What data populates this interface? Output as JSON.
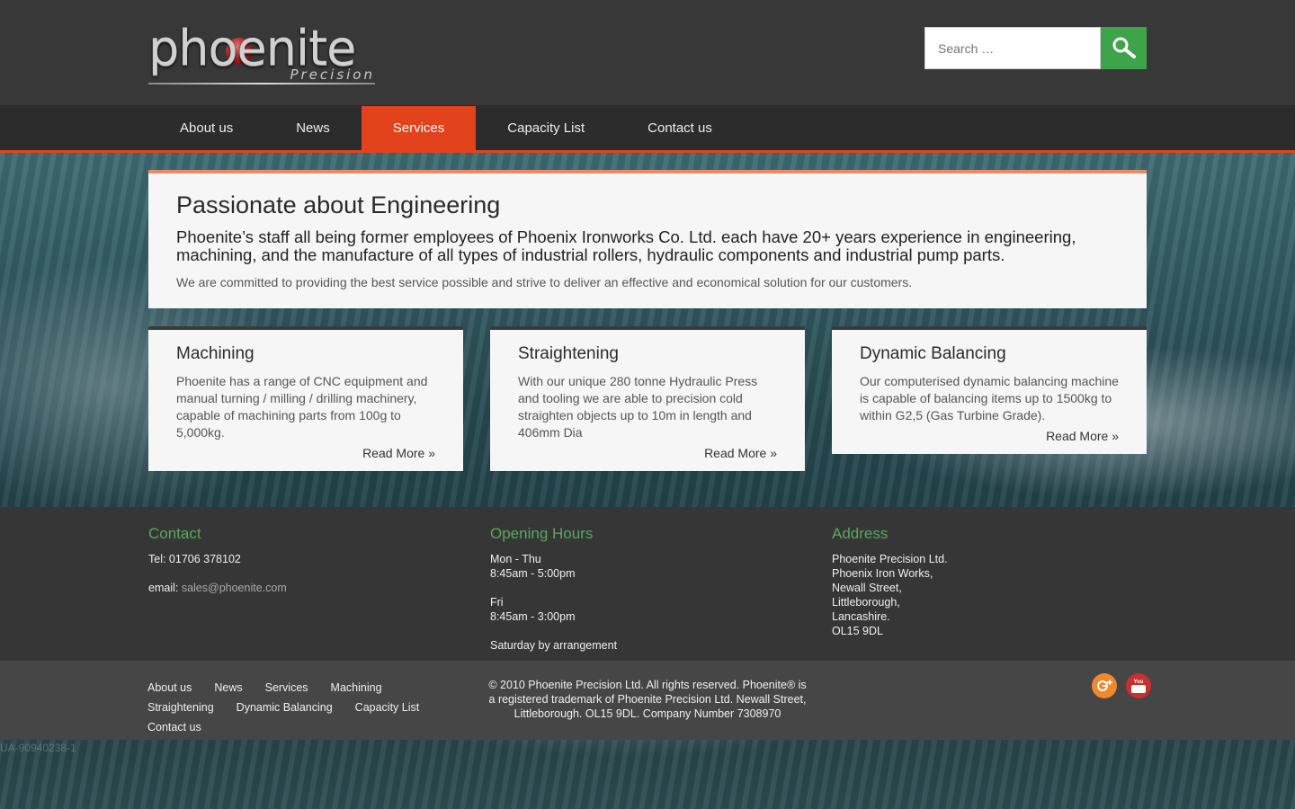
{
  "header": {
    "logo_text": "phoenite",
    "logo_sub": "Precision",
    "search_placeholder": "Search …"
  },
  "nav": {
    "items": [
      {
        "label": "About us",
        "active": false
      },
      {
        "label": "News",
        "active": false
      },
      {
        "label": "Services",
        "active": true
      },
      {
        "label": "Capacity List",
        "active": false
      },
      {
        "label": "Contact us",
        "active": false
      }
    ]
  },
  "hero": {
    "title": "Passionate about Engineering",
    "lead": "Phoenite’s staff all being former employees of Phoenix Ironworks Co. Ltd. each have 20+ years experience in engineering, machining, and the manufacture of all types of industrial rollers, hydraulic components and industrial pump parts.",
    "text": "We are committed to providing the best service possible and strive to deliver an effective and economical solution for our customers."
  },
  "cards": [
    {
      "title": "Machining",
      "text": "Phoenite has a range of CNC equipment and manual turning / milling / drilling machinery, capable of machining parts from 100g to 5,000kg.",
      "more": "Read More »"
    },
    {
      "title": "Straightening",
      "text": "With our unique 280 tonne Hydraulic Press and tooling we are able to precision cold straighten objects up to 10m in length and 406mm Dia",
      "more": "Read More »"
    },
    {
      "title": "Dynamic Balancing",
      "text": "Our computerised dynamic balancing machine is capable of balancing items up to 1500kg to within G2,5 (Gas Turbine Grade).",
      "more": "Read More »"
    }
  ],
  "footer": {
    "contact": {
      "heading": "Contact",
      "tel": "Tel: 01706 378102",
      "email_label": "email:",
      "email": "sales@phoenite.com"
    },
    "hours": {
      "heading": "Opening Hours",
      "weekday_label": "Mon - Thu",
      "weekday_hours": "8:45am - 5:00pm",
      "fri_label": "Fri",
      "fri_hours": "8:45am - 3:00pm",
      "saturday": "Saturday by arrangement"
    },
    "address": {
      "heading": "Address",
      "lines": [
        "Phoenite Precision Ltd.",
        "Phoenix Iron Works,",
        "Newall Street,",
        "Littleborough,",
        "Lancashire.",
        "OL15 9DL"
      ]
    },
    "links": [
      "About us",
      "News",
      "Services",
      "Machining",
      "Straightening",
      "Dynamic Balancing",
      "Capacity List",
      "Contact us"
    ],
    "copyright": "© 2010 Phoenite Precision Ltd. All rights reserved. Phoenite® is a registered trademark of Phoenite Precision Ltd. Newall Street, Littleborough. OL15 9DL. Company Number 7308970",
    "social": [
      {
        "icon": "google-plus-icon",
        "color": "#f0892b"
      },
      {
        "icon": "youtube-icon",
        "color": "#c8302e",
        "label": "You Tube"
      }
    ]
  },
  "analytics_id": "UA-90940238-1",
  "colors": {
    "accent": "#e2421c",
    "green": "#3ea44a",
    "footer_heading": "#58a95a"
  }
}
